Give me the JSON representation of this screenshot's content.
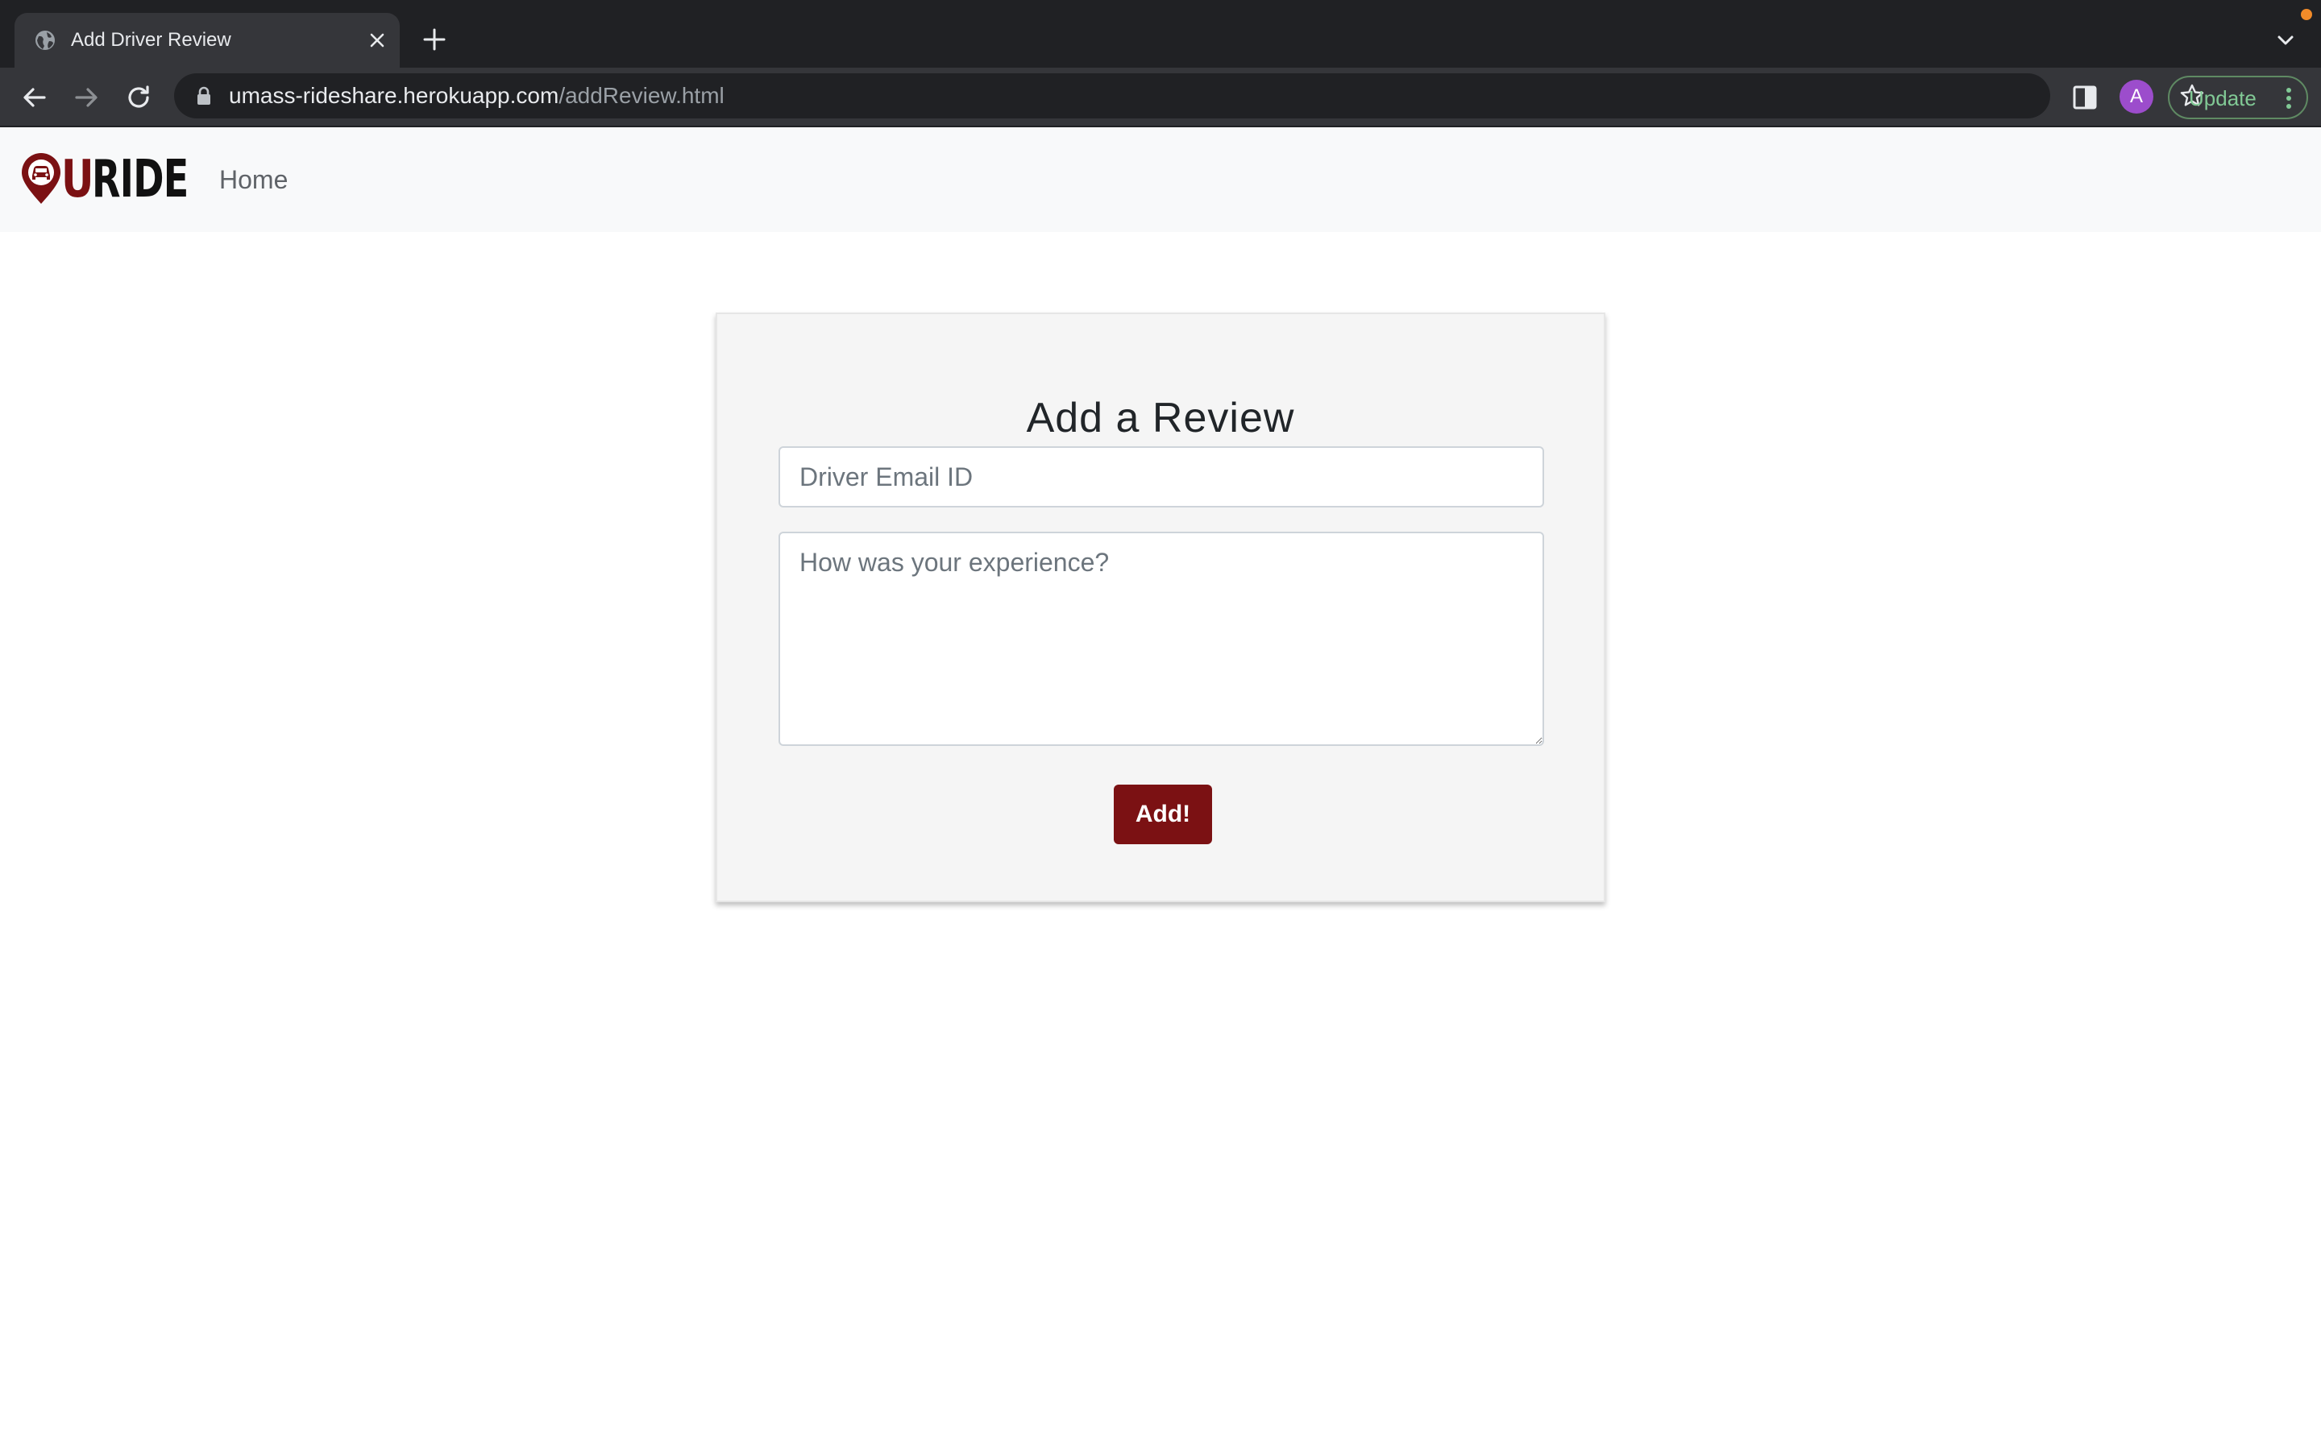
{
  "browser": {
    "tab_title": "Add Driver Review",
    "url_host": "umass-rideshare.herokuapp.com",
    "url_path": "/addReview.html",
    "profile_initial": "A",
    "update_label": "Update"
  },
  "site": {
    "logo_u": "U",
    "logo_rest": "RIDE",
    "nav_home": "Home",
    "brand_color": "#7b1113"
  },
  "form": {
    "title": "Add a Review",
    "email_placeholder": "Driver Email ID",
    "email_value": "",
    "review_placeholder": "How was your experience?",
    "review_value": "",
    "submit_label": "Add!"
  }
}
